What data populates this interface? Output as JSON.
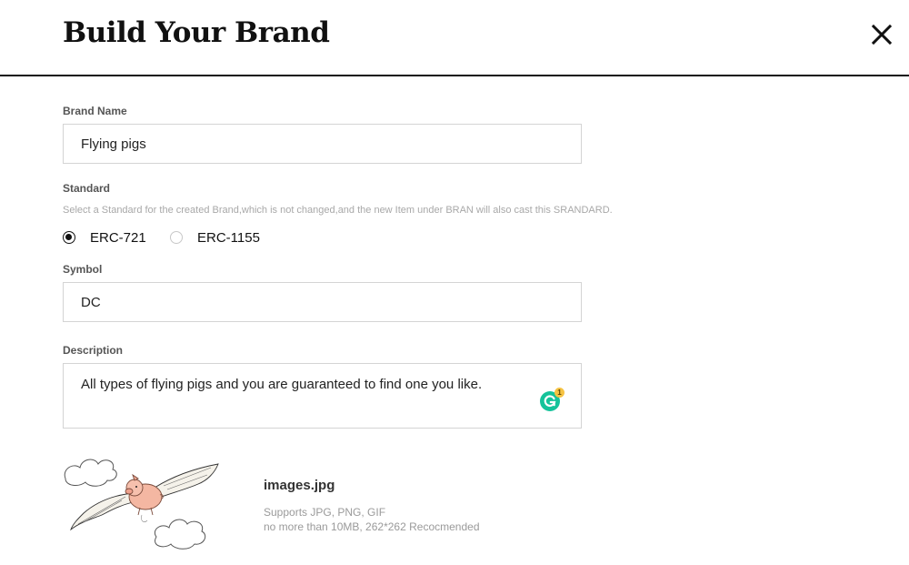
{
  "header": {
    "title": "Build Your Brand",
    "close_icon": "close-icon"
  },
  "form": {
    "brand_name": {
      "label": "Brand Name",
      "value": "Flying pigs"
    },
    "standard": {
      "label": "Standard",
      "hint": "Select a Standard for the created Brand,which is not changed,and the new Item under BRAN will also cast this SRANDARD.",
      "options": [
        {
          "label": "ERC-721",
          "selected": true
        },
        {
          "label": "ERC-1155",
          "selected": false
        }
      ]
    },
    "symbol": {
      "label": "Symbol",
      "value": "DC"
    },
    "description": {
      "label": "Description",
      "value": "All types of flying pigs and you are guaranteed to find one you like.",
      "grammarly_count": "1"
    }
  },
  "upload": {
    "file_name": "images.jpg",
    "supports": "Supports JPG, PNG, GIF",
    "limits": "no more than 10MB, 262*262 Recocmended"
  },
  "colors": {
    "grammarly": "#15c39a",
    "border": "#d4d4d4",
    "hint": "#a8a8a8"
  }
}
